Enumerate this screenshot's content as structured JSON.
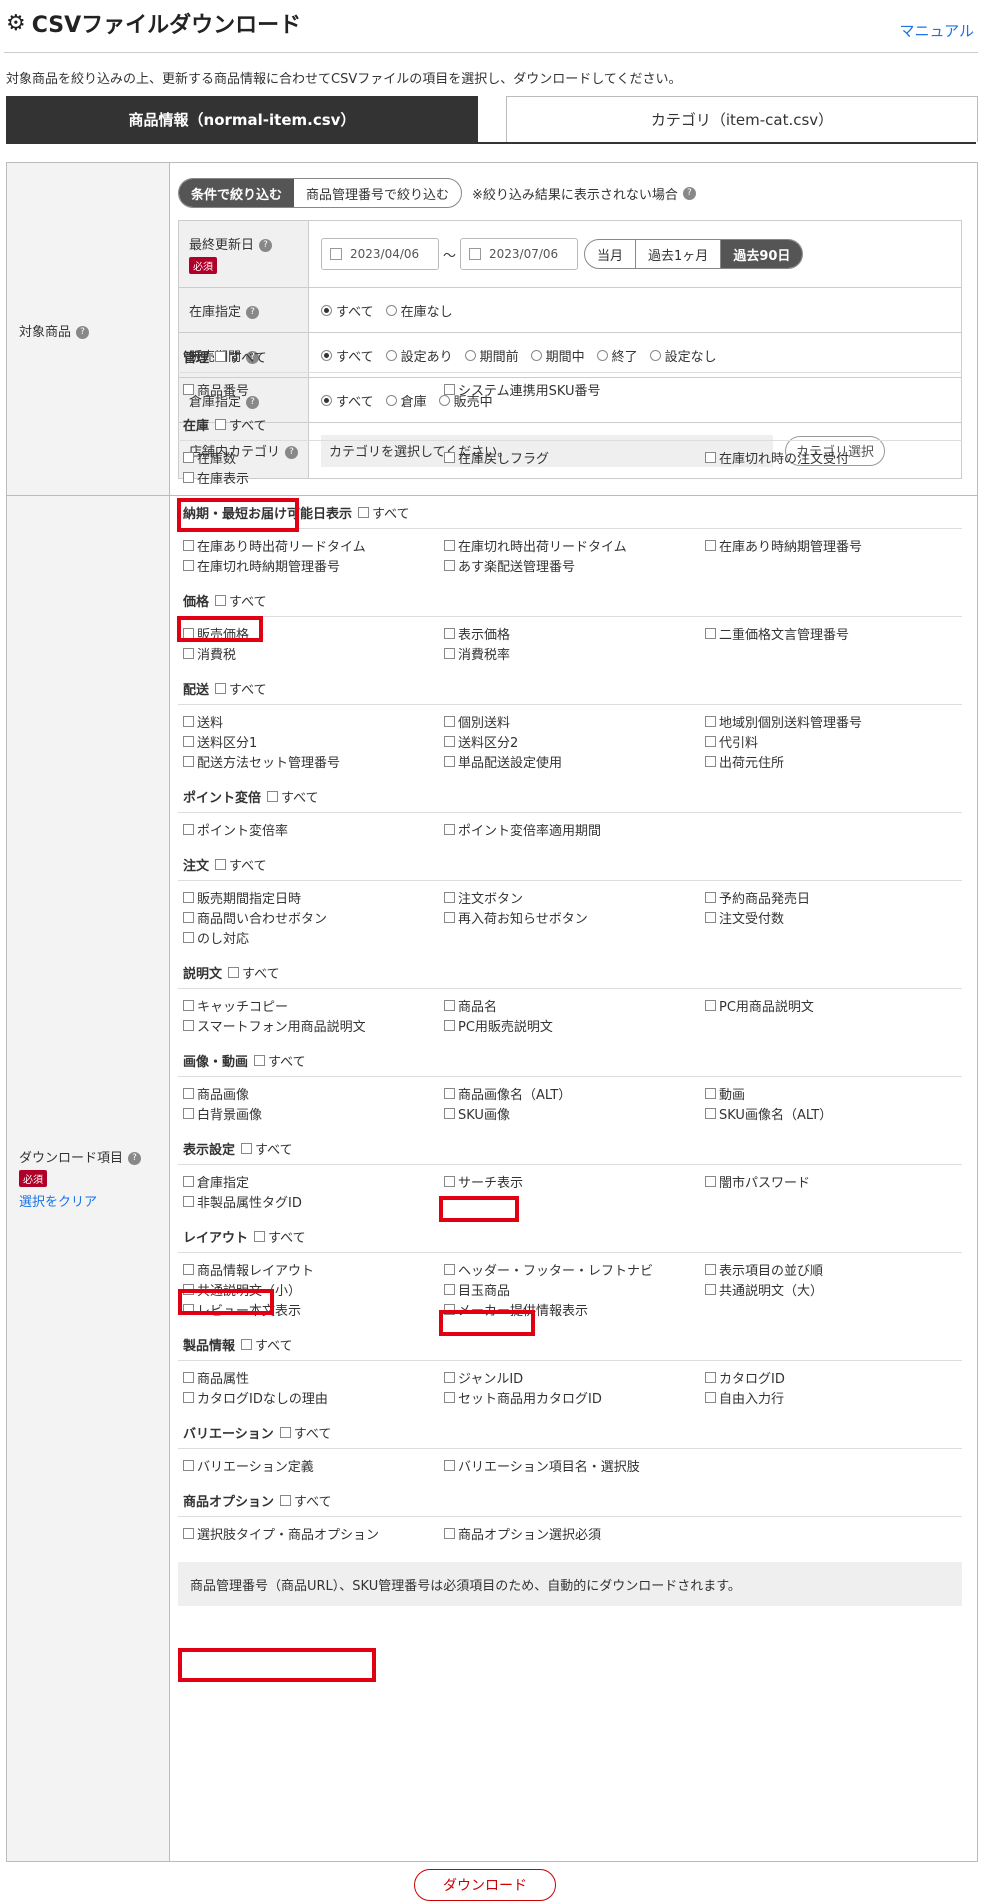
{
  "header": {
    "title": "CSVファイルダウンロード",
    "manual_link": "マニュアル",
    "description": "対象商品を絞り込みの上、更新する商品情報に合わせてCSVファイルの項目を選択し、ダウンロードしてください。"
  },
  "tabs": [
    {
      "label": "商品情報（normal-item.csv）",
      "active": true
    },
    {
      "label": "カテゴリ（item-cat.csv）",
      "active": false
    }
  ],
  "target": {
    "label": "対象商品",
    "filter_mode": [
      "条件で絞り込む",
      "商品管理番号で絞り込む"
    ],
    "filter_note": "※絞り込み結果に表示されない場合",
    "rows": {
      "updated": {
        "label": "最終更新日",
        "required": "必須",
        "from": "2023/04/06",
        "to": "2023/07/06",
        "tilde": "〜",
        "ranges": [
          "当月",
          "過去1ヶ月",
          "過去90日"
        ]
      },
      "stock": {
        "label": "在庫指定",
        "options": [
          "すべて",
          "在庫なし"
        ]
      },
      "sale_period": {
        "label": "販売期間",
        "options": [
          "すべて",
          "設定あり",
          "期間前",
          "期間中",
          "終了",
          "設定なし"
        ]
      },
      "warehouse": {
        "label": "倉庫指定",
        "options": [
          "すべて",
          "倉庫",
          "販売中"
        ]
      },
      "category": {
        "label": "店舗内カテゴリ",
        "placeholder": "カテゴリを選択してください。",
        "button": "カテゴリ選択"
      }
    }
  },
  "download_items": {
    "label": "ダウンロード項目",
    "required": "必須",
    "clear": "選択をクリア",
    "all_label": "すべて",
    "groups": [
      {
        "name": "管理",
        "items": [
          "商品番号",
          "システム連携用SKU番号"
        ]
      },
      {
        "name": "在庫",
        "items": [
          "在庫数",
          "在庫戻しフラグ",
          "在庫切れ時の注文受付",
          "在庫表示"
        ]
      },
      {
        "name": "納期・最短お届け可能日表示",
        "items": [
          "在庫あり時出荷リードタイム",
          "在庫切れ時出荷リードタイム",
          "在庫あり時納期管理番号",
          "在庫切れ時納期管理番号",
          "あす楽配送管理番号"
        ]
      },
      {
        "name": "価格",
        "items": [
          "販売価格",
          "表示価格",
          "二重価格文言管理番号",
          "消費税",
          "消費税率"
        ]
      },
      {
        "name": "配送",
        "items": [
          "送料",
          "個別送料",
          "地域別個別送料管理番号",
          "送料区分1",
          "送料区分2",
          "代引料",
          "配送方法セット管理番号",
          "単品配送設定使用",
          "出荷元住所"
        ]
      },
      {
        "name": "ポイント変倍",
        "items": [
          "ポイント変倍率",
          "ポイント変倍率適用期間"
        ]
      },
      {
        "name": "注文",
        "items": [
          "販売期間指定日時",
          "注文ボタン",
          "予約商品発売日",
          "商品問い合わせボタン",
          "再入荷お知らせボタン",
          "注文受付数",
          "のし対応"
        ]
      },
      {
        "name": "説明文",
        "items": [
          "キャッチコピー",
          "商品名",
          "PC用商品説明文",
          "スマートフォン用商品説明文",
          "PC用販売説明文"
        ]
      },
      {
        "name": "画像・動画",
        "items": [
          "商品画像",
          "商品画像名（ALT）",
          "動画",
          "白背景画像",
          "SKU画像",
          "SKU画像名（ALT）"
        ]
      },
      {
        "name": "表示設定",
        "items": [
          "倉庫指定",
          "サーチ表示",
          "闇市パスワード",
          "非製品属性タグID"
        ]
      },
      {
        "name": "レイアウト",
        "items": [
          "商品情報レイアウト",
          "ヘッダー・フッター・レフトナビ",
          "表示項目の並び順",
          "共通説明文（小）",
          "目玉商品",
          "共通説明文（大）",
          "レビュー本文表示",
          "メーカー提供情報表示"
        ]
      },
      {
        "name": "製品情報",
        "items": [
          "商品属性",
          "ジャンルID",
          "カタログID",
          "カタログIDなしの理由",
          "セット商品用カタログID",
          "自由入力行"
        ]
      },
      {
        "name": "バリエーション",
        "items": [
          "バリエーション定義",
          "バリエーション項目名・選択肢"
        ]
      },
      {
        "name": "商品オプション",
        "items": [
          "選択肢タイプ・商品オプション",
          "商品オプション選択必須"
        ]
      }
    ],
    "footnote": "商品管理番号（商品URL）、SKU管理番号は必須項目のため、自動的にダウンロードされます。"
  },
  "download_button": "ダウンロード"
}
